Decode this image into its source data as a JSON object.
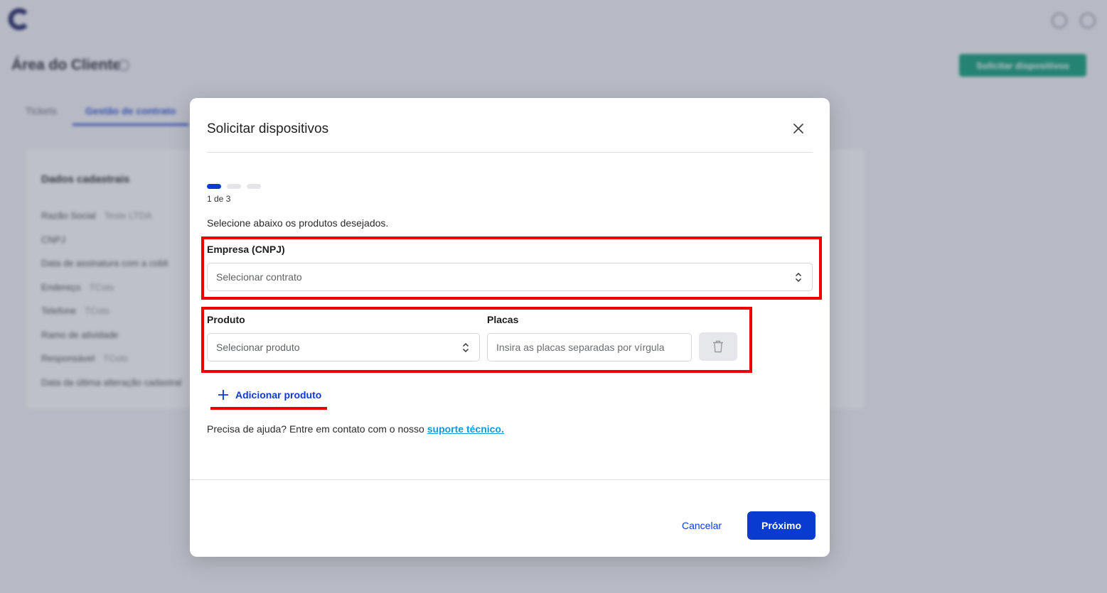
{
  "background": {
    "page_title": "Área do Cliente",
    "cta_label": "Solicitar dispositivos",
    "tabs": [
      "Tickets",
      "Gestão de contrato"
    ],
    "card_title": "Dados cadastrais",
    "rows": [
      {
        "label": "Razão Social",
        "value": "Teste LTDA"
      },
      {
        "label": "CNPJ",
        "value": ""
      },
      {
        "label": "Data de assinatura com a cobli",
        "value": ""
      },
      {
        "label": "Endereço",
        "value": "TCots"
      },
      {
        "label": "Telefone",
        "value": "TCots"
      },
      {
        "label": "Ramo de atividade",
        "value": ""
      },
      {
        "label": "Responsável",
        "value": "TCots"
      },
      {
        "label": "Data da última alteração cadastral",
        "value": ""
      }
    ]
  },
  "modal": {
    "title": "Solicitar dispositivos",
    "step_counter": "1 de 3",
    "steps_total": 3,
    "current_step": 1,
    "instructions": "Selecione abaixo os produtos desejados.",
    "empresa_label": "Empresa (CNPJ)",
    "empresa_placeholder": "Selecionar contrato",
    "produto_label": "Produto",
    "produto_placeholder": "Selecionar produto",
    "placas_label": "Placas",
    "placas_placeholder": "Insira as placas separadas por vírgula",
    "add_product_label": "Adicionar produto",
    "help_text": "Precisa de ajuda? Entre em contato com o nosso ",
    "help_link": "suporte técnico.",
    "cancel_label": "Cancelar",
    "next_label": "Próximo"
  },
  "colors": {
    "primary": "#0a3bd1",
    "annotation": "#ee0000",
    "link": "#1798d6",
    "background_cta": "#1aa37f"
  }
}
